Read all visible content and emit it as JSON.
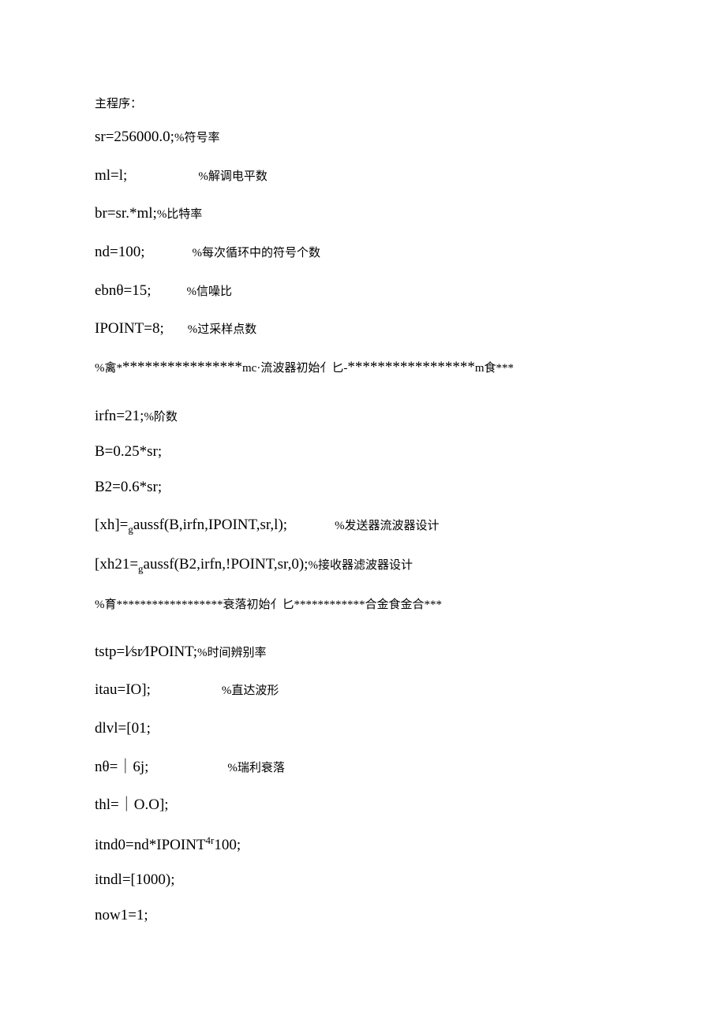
{
  "lines": {
    "l1": "主程序：",
    "l2a": "sr=256000.0;",
    "l2b": "%符号率",
    "l3a": "ml=l;",
    "l3b": "%解调电平数",
    "l4a": "br=sr.*ml;",
    "l4b": "%比特率",
    "l5a": "nd=100;",
    "l5b": "%每次循环中的符号个数",
    "l6a": "ebnθ=15;",
    "l6b": "%信噪比",
    "l7a": "IPOINT=8;",
    "l7b": "%过采样点数",
    "l8a": "%禽*",
    "l8b": "****************",
    "l8c": "mc·流波器初始亻匕-",
    "l8d": "*****************",
    "l8e": "m食***",
    "l9a": "irfn=21;",
    "l9b": "%阶数",
    "l10": "B=0.25*sr;",
    "l11": "B2=0.6*sr;",
    "l12a": "[xh]=",
    "l12sub": "g",
    "l12b": "aussf(B,irfn,IPOINT,sr,l);",
    "l12c": "%发送器流波器设计",
    "l13a": "[xh21=",
    "l13sub": "g",
    "l13b": "aussf(B2,irfn,!POINT,sr,0);",
    "l13c": "%接收器滤波器设计",
    "l14a": "%育******************衰落初始亻匕************合金食金合***",
    "l15a": "tstp=l⁄sr⁄IPOINT;",
    "l15b": "%时间辨别率",
    "l16a": "itau=IO];",
    "l16b": "%直达波形",
    "l17": "dlvl=[01;",
    "l18a": "nθ=｜6j;",
    "l18b": "%瑞利衰落",
    "l19": "thl=｜O.O];",
    "l20a": "itnd0=nd*IPOINT",
    "l20sup": "4r",
    "l20b": "100;",
    "l21": "itndl=[1000);",
    "l22": "now1=1;"
  }
}
